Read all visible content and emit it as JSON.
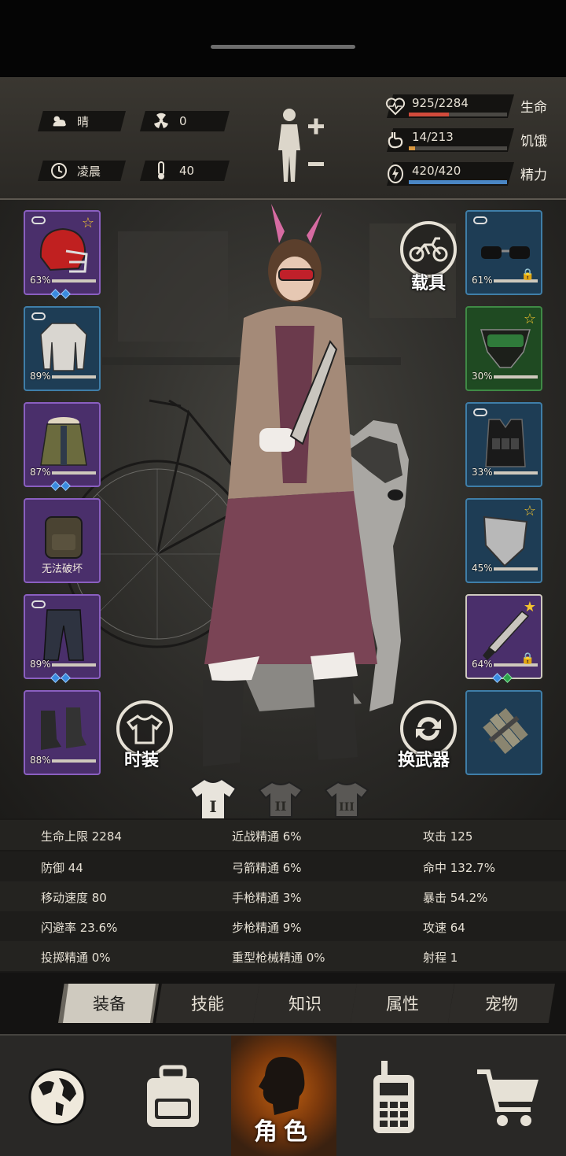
{
  "status": {
    "weather": "晴",
    "radiation": "0",
    "time_of_day": "凌晨",
    "temperature": "40",
    "health": {
      "value": "925/2284",
      "label": "生命",
      "fill": 0.405,
      "color": "#d24b3c"
    },
    "hunger": {
      "value": "14/213",
      "label": "饥饿",
      "fill": 0.066,
      "color": "#d99840"
    },
    "energy": {
      "value": "420/420",
      "label": "精力",
      "fill": 1.0,
      "color": "#4a86c4"
    }
  },
  "equipment_left": [
    {
      "name": "头盔",
      "pct": "63%",
      "rarity": "purple",
      "star": true,
      "gems": [
        "blue",
        "blue"
      ]
    },
    {
      "name": "上衣",
      "pct": "89%",
      "rarity": "blue",
      "star": false,
      "gems": []
    },
    {
      "name": "外套",
      "pct": "87%",
      "rarity": "purple",
      "star": false,
      "gems": [
        "blue",
        "blue"
      ]
    },
    {
      "name": "背包",
      "pct": "",
      "broken_text": "无法破坏",
      "rarity": "purple",
      "star": false,
      "gems": []
    },
    {
      "name": "裤子",
      "pct": "89%",
      "rarity": "purple",
      "star": false,
      "gems": [
        "blue",
        "blue"
      ]
    },
    {
      "name": "靴子",
      "pct": "88%",
      "rarity": "purple",
      "star": false,
      "gems": []
    }
  ],
  "equipment_right": [
    {
      "name": "眼镜",
      "pct": "61%",
      "rarity": "blue",
      "star": false,
      "lock": true
    },
    {
      "name": "面罩",
      "pct": "30%",
      "rarity": "green",
      "star": true,
      "lock": false
    },
    {
      "name": "护甲",
      "pct": "33%",
      "rarity": "blue",
      "star": false,
      "lock": false
    },
    {
      "name": "盾牌",
      "pct": "45%",
      "rarity": "blue",
      "star": true,
      "lock": false
    },
    {
      "name": "砍刀",
      "pct": "64%",
      "rarity": "purple",
      "star": true,
      "lock": true,
      "gems": [
        "blue",
        "green"
      ]
    },
    {
      "name": "炸药",
      "pct": "",
      "rarity": "blue",
      "star": false,
      "lock": false
    }
  ],
  "buttons": {
    "vehicle": "载具",
    "fashion": "时装",
    "swap_weapon": "换武器"
  },
  "outfit_tabs": [
    "I",
    "II",
    "III"
  ],
  "attributes": [
    [
      "生命上限 2284",
      "近战精通 6%",
      "攻击 125"
    ],
    [
      "防御 44",
      "弓箭精通 6%",
      "命中 132.7%"
    ],
    [
      "移动速度 80",
      "手枪精通 3%",
      "暴击 54.2%"
    ],
    [
      "闪避率 23.6%",
      "步枪精通 9%",
      "攻速 64"
    ],
    [
      "投掷精通 0%",
      "重型枪械精通 0%",
      "射程 1"
    ]
  ],
  "subtabs": [
    "装备",
    "技能",
    "知识",
    "属性",
    "宠物"
  ],
  "active_subtab": "装备",
  "nav": {
    "world": "world-map",
    "bag": "backpack",
    "character": "角色",
    "radio": "walkie-talkie",
    "shop": "shopping-cart"
  }
}
